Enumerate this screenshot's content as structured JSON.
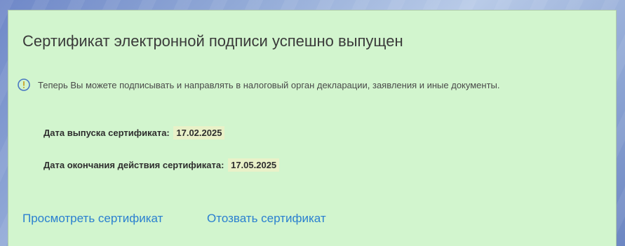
{
  "panel": {
    "title": "Сертификат электронной подписи успешно выпущен",
    "info": {
      "icon": "info-circle-icon",
      "icon_color": "#4a78c2",
      "text": "Теперь Вы можете подписывать и направлять в налоговый орган декларации, заявления и иные документы."
    },
    "fields": {
      "issue_label": "Дата выпуска сертификата:",
      "issue_value": "17.02.2025",
      "expiry_label": "Дата окончания действия сертификата:",
      "expiry_value": "17.05.2025"
    },
    "links": {
      "view": "Просмотреть сертификат",
      "revoke": "Отозвать сертификат"
    }
  },
  "colors": {
    "panel_background": "#d2f5ce",
    "link": "#2a7fd0",
    "value_highlight": "#e9f1c8"
  }
}
